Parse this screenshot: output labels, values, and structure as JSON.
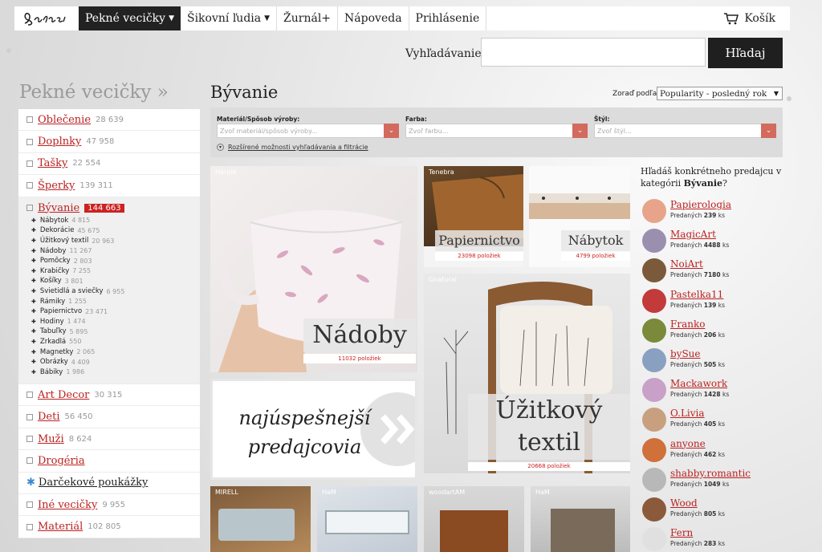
{
  "topnav": {
    "logo_text": "Sashe.sk",
    "items": [
      {
        "label": "Pekné vecičky",
        "has_caret": true,
        "active": true
      },
      {
        "label": "Šikovní ľudia",
        "has_caret": true,
        "active": false
      },
      {
        "label": "Žurnál+",
        "has_caret": false,
        "active": false
      },
      {
        "label": "Nápoveda",
        "has_caret": false,
        "active": false
      },
      {
        "label": "Prihlásenie",
        "has_caret": false,
        "active": false
      }
    ],
    "cart_label": "Košík"
  },
  "search": {
    "label": "Vyhľadávanie:",
    "value": "",
    "button": "Hľadaj"
  },
  "sidebar": {
    "title": "Pekné vecičky »",
    "before": [
      {
        "label": "Oblečenie",
        "count": "28 639"
      },
      {
        "label": "Doplnky",
        "count": "47 958"
      },
      {
        "label": "Tašky",
        "count": "22 554"
      },
      {
        "label": "Šperky",
        "count": "139 311"
      }
    ],
    "active": {
      "label": "Bývanie",
      "count": "144 663",
      "subs": [
        {
          "label": "Nábytok",
          "count": "4 815"
        },
        {
          "label": "Dekorácie",
          "count": "45 675"
        },
        {
          "label": "Úžitkový textil",
          "count": "20 963"
        },
        {
          "label": "Nádoby",
          "count": "11 267"
        },
        {
          "label": "Pomôcky",
          "count": "2 803"
        },
        {
          "label": "Krabičky",
          "count": "7 255"
        },
        {
          "label": "Košíky",
          "count": "3 801"
        },
        {
          "label": "Svietidlá a sviečky",
          "count": "6 955"
        },
        {
          "label": "Rámiky",
          "count": "1 255"
        },
        {
          "label": "Papiernictvo",
          "count": "23 471"
        },
        {
          "label": "Hodiny",
          "count": "1 474"
        },
        {
          "label": "Tabuľky",
          "count": "5 895"
        },
        {
          "label": "Zrkadlá",
          "count": "550"
        },
        {
          "label": "Magnetky",
          "count": "2 065"
        },
        {
          "label": "Obrázky",
          "count": "4 409"
        },
        {
          "label": "Bábiky",
          "count": "1 986"
        }
      ]
    },
    "after": [
      {
        "label": "Art Decor",
        "count": "30 315"
      },
      {
        "label": "Deti",
        "count": "56 450"
      },
      {
        "label": "Muži",
        "count": "8 624"
      },
      {
        "label": "Drogéria",
        "count": ""
      },
      {
        "label": "Darčekové poukážky",
        "count": "",
        "gift": true
      },
      {
        "label": "Iné vecičky",
        "count": "9 955"
      },
      {
        "label": "Materiál",
        "count": "102 805"
      }
    ]
  },
  "main": {
    "title": "Bývanie",
    "sort": {
      "label": "Zoraď podľa:",
      "value": "Popularity - posledný rok"
    },
    "filters": [
      {
        "label": "Materiál/Spôsob výroby:",
        "placeholder": "Zvoľ materiál/spôsob výroby..."
      },
      {
        "label": "Farba:",
        "placeholder": "Zvoľ farbu..."
      },
      {
        "label": "Štýl:",
        "placeholder": "Zvoľ štýl..."
      }
    ],
    "advanced_link": "Rozšírené možnosti vyhľadávania a filtrácie"
  },
  "tiles": {
    "nadoby": {
      "author": "Harpie",
      "label": "Nádoby",
      "count": "11032 položiek"
    },
    "papiernictvo": {
      "author": "Tenebra",
      "label": "Papiernictvo",
      "count": "23098 položiek"
    },
    "nabytok": {
      "author": "",
      "label": "Nábytok",
      "count": "4799 položiek"
    },
    "textil": {
      "author": "Gnatural",
      "label": "Úžitkový textil",
      "count": "20668 položiek"
    },
    "promo": {
      "text": "najúspešnejší predajcovia"
    },
    "bottom": [
      {
        "author": "MIRELL"
      },
      {
        "author": "HaM"
      },
      {
        "author": "woodartAM"
      },
      {
        "author": "HaM"
      }
    ]
  },
  "sellers_panel": {
    "title_prefix": "Hľadáš konkrétneho predajcu v kategórii ",
    "title_category": "Bývanie",
    "title_suffix": "?",
    "sold_label": "Predaných",
    "unit": "ks",
    "sellers": [
      {
        "name": "Papierologia",
        "sold": "239",
        "color": "#e8a48a"
      },
      {
        "name": "MagicArt",
        "sold": "4488",
        "color": "#9b8fb0"
      },
      {
        "name": "NoiArt",
        "sold": "7180",
        "color": "#7a5a3a"
      },
      {
        "name": "Pastelka11",
        "sold": "139",
        "color": "#c33a3a"
      },
      {
        "name": "Franko",
        "sold": "206",
        "color": "#7a8a3a"
      },
      {
        "name": "bySue",
        "sold": "505",
        "color": "#8aa0c0"
      },
      {
        "name": "Mackawork",
        "sold": "1428",
        "color": "#c8a0c8"
      },
      {
        "name": "O.Livia",
        "sold": "405",
        "color": "#c8a080"
      },
      {
        "name": "anyone",
        "sold": "462",
        "color": "#d0703a"
      },
      {
        "name": "shabby.romantic",
        "sold": "1049",
        "color": "#b8b8b8"
      },
      {
        "name": "Wood",
        "sold": "805",
        "color": "#8a5a3a"
      },
      {
        "name": "Fern",
        "sold": "283",
        "color": "#e0e0e0"
      }
    ]
  }
}
